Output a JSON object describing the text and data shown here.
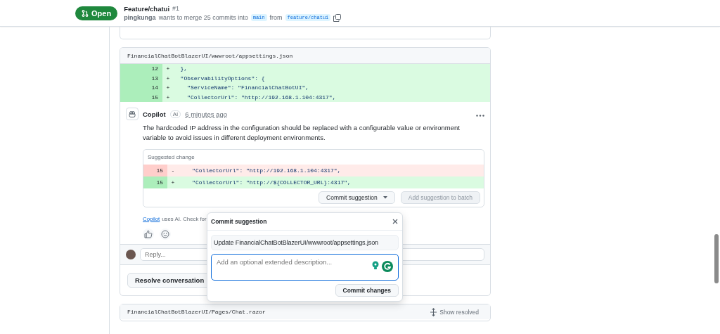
{
  "header": {
    "status": "Open",
    "title": "Feature/chatui",
    "number": "#1",
    "author": "pingkunga",
    "merge_text": "wants to merge 25 commits into",
    "base_branch": "main",
    "from_text": "from",
    "head_branch": "feature/chatui"
  },
  "file": {
    "path": "FinancialChatBotBlazerUI/wwwroot/appsettings.json",
    "lines": [
      {
        "number": "12",
        "sign": "+",
        "code": "  },"
      },
      {
        "number": "13",
        "sign": "+",
        "code": "  \"ObservabilityOptions\": {"
      },
      {
        "number": "14",
        "sign": "+",
        "code": "    \"ServiceName\": \"FinancialChatBotUI\","
      },
      {
        "number": "15",
        "sign": "+",
        "code": "    \"CollectorUrl\": \"http://192.168.1.104:4317\","
      }
    ]
  },
  "comment": {
    "author": "Copilot",
    "badge": "AI",
    "time": "6 minutes ago",
    "body": "The hardcoded IP address in the configuration should be replaced with a configurable value or environment variable to avoid issues in different deployment environments.",
    "suggestion": {
      "title": "Suggested change",
      "lines": [
        {
          "kind": "deleted",
          "number": "15",
          "sign": "-",
          "code": "    \"CollectorUrl\": \"http://192.168.1.104:4317\","
        },
        {
          "kind": "added",
          "number": "15",
          "sign": "+",
          "code": "    \"CollectorUrl\": \"http://${COLLECTOR_URL}:4317\","
        }
      ],
      "buttons": [
        {
          "label": "Commit suggestion",
          "disabled": false,
          "dropdown": true
        },
        {
          "label": "Add suggestion to batch",
          "disabled": true,
          "dropdown": false
        }
      ]
    },
    "disclaimer_link": "Copilot",
    "disclaimer": "uses AI. Check for"
  },
  "reply": {
    "placeholder": "Reply..."
  },
  "resolve_button": "Resolve conversation",
  "next_file": {
    "path": "FinancialChatBotBlazerUI/Pages/Chat.razor",
    "action": "Show resolved"
  },
  "commit_popup": {
    "title": "Commit suggestion",
    "message": "Update FinancialChatBotBlazerUI/wwwroot/appsettings.json",
    "description_placeholder": "Add an optional extended description...",
    "submit": "Commit changes"
  }
}
